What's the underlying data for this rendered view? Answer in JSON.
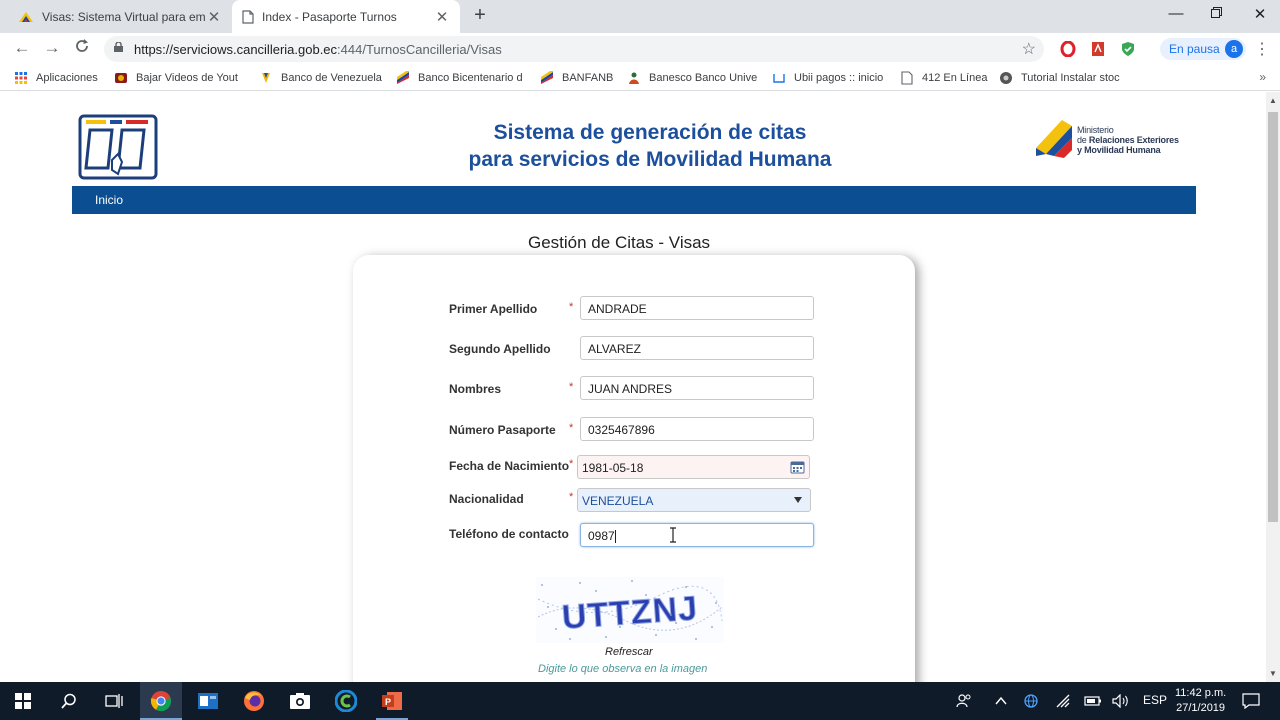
{
  "browser": {
    "tabs": [
      {
        "title": "Visas: Sistema Virtual para emisio",
        "active": false
      },
      {
        "title": "Index - Pasaporte Turnos",
        "active": true
      }
    ],
    "url_main": "https://serviciows.cancilleria.gob.ec",
    "url_rest": ":444/TurnosCancilleria/Visas",
    "profile_status": "En pausa",
    "profile_initial": "a",
    "bookmarks": [
      "Aplicaciones",
      "Bajar Videos de Yout",
      "Banco de Venezuela",
      "Banco Bicentenario d",
      "BANFANB",
      "Banesco Banco Unive",
      "Ubii pagos :: inicio",
      "412 En Línea",
      "Tutorial Instalar stoc"
    ]
  },
  "site": {
    "title_line1": "Sistema de generación de citas",
    "title_line2": "para servicios de Movilidad Humana",
    "ministry_line1": "Ministerio",
    "ministry_line2_prefix": "de ",
    "ministry_line2_bold": "Relaciones Exteriores",
    "ministry_line3": "y Movilidad Humana",
    "nav_home": "Inicio",
    "page_heading": "Gestión de Citas - Visas"
  },
  "form": {
    "required_mark": "*",
    "fields": [
      {
        "label": "Primer Apellido",
        "value": "ANDRADE"
      },
      {
        "label": "Segundo Apellido",
        "value": "ALVAREZ"
      },
      {
        "label": "Nombres",
        "value": "JUAN ANDRES"
      },
      {
        "label": "Número Pasaporte",
        "value": "0325467896"
      },
      {
        "label": "Fecha de Nacimiento",
        "value": "1981-05-18"
      },
      {
        "label": "Nacionalidad",
        "value": "VENEZUELA"
      },
      {
        "label": "Teléfono de contacto",
        "value": "0987"
      }
    ],
    "captcha_text": "UTTZNJ",
    "refresh_label": "Refrescar",
    "captcha_hint": "Digite lo que observa en la imagen"
  },
  "taskbar": {
    "language": "ESP",
    "time": "11:42 p.m.",
    "date": "27/1/2019"
  },
  "colors": {
    "brand_blue": "#1c4f9c",
    "nav_blue": "#0b4f92",
    "required_red": "#c0392b",
    "hint_teal": "#4a9a9a"
  }
}
